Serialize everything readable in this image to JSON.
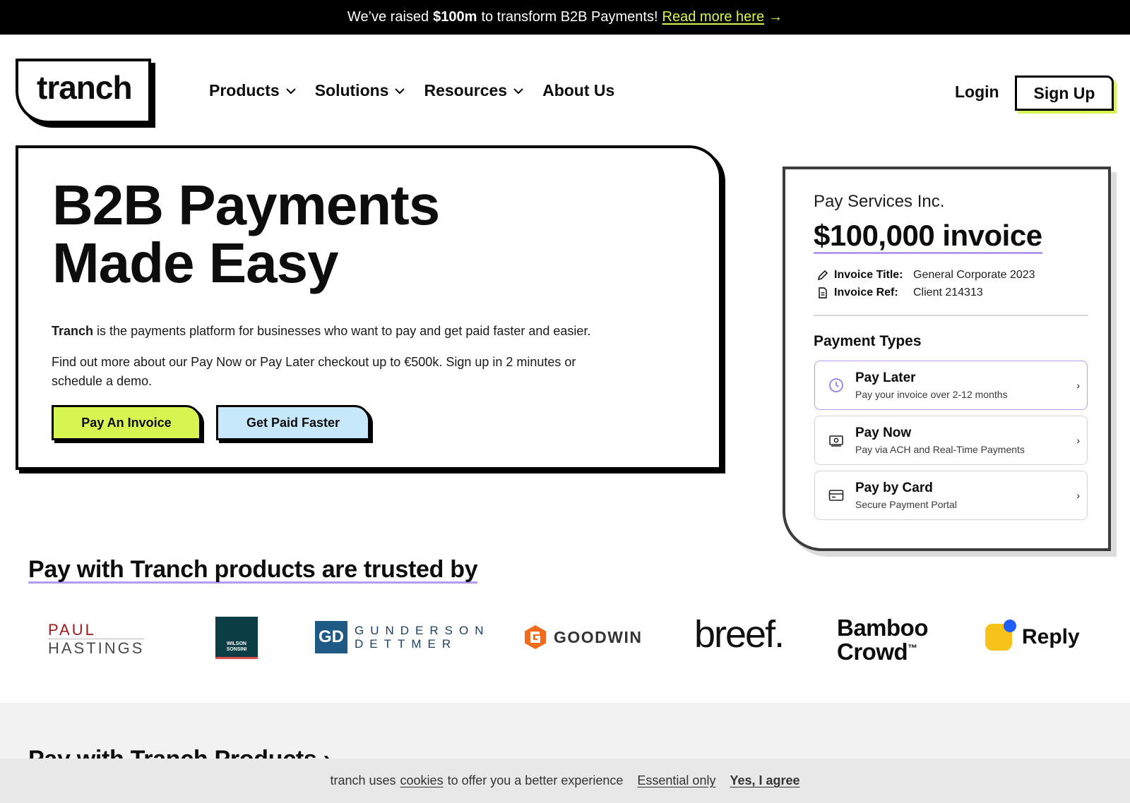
{
  "announcement": {
    "prefix": "We’ve raised",
    "amount": "$100m",
    "suffix": "to transform B2B Payments!",
    "link": "Read more here",
    "arrow": "→"
  },
  "header": {
    "logo_text": "tranch",
    "nav": [
      "Products",
      "Solutions",
      "Resources",
      "About Us"
    ],
    "login": "Login",
    "signup": "Sign Up"
  },
  "hero": {
    "title_line1": "B2B Payments",
    "title_line2": "Made Easy",
    "brand": "Tranch",
    "para1_rest": "is the payments platform for businesses who want to pay and get paid faster and easier.",
    "para2": "Find out more about our Pay Now or Pay Later checkout up to €500k. Sign up in 2 minutes or schedule a demo.",
    "btn_pay": "Pay An Invoice",
    "btn_get": "Get Paid Faster"
  },
  "invoice": {
    "company": "Pay Services Inc.",
    "amount": "$100,000 invoice",
    "title_label": "Invoice Title:",
    "title_value": "General Corporate 2023",
    "ref_label": "Invoice Ref:",
    "ref_value": "Client 214313",
    "payment_types_title": "Payment Types",
    "options": [
      {
        "name": "Pay Later",
        "desc": "Pay your invoice over 2-12 months",
        "icon": "clock-icon"
      },
      {
        "name": "Pay Now",
        "desc": "Pay via ACH and Real-Time Payments",
        "icon": "cash-icon"
      },
      {
        "name": "Pay by Card",
        "desc": "Secure Payment Portal",
        "icon": "card-icon"
      }
    ],
    "arrow": "›"
  },
  "trusted": {
    "title": "Pay with Tranch products are trusted by",
    "logos": {
      "paul_1": "PAUL",
      "paul_2": "HASTINGS",
      "wilson_1": "WILSON",
      "wilson_2": "SONSINI",
      "gund_mono": "GD",
      "gund_1": "GUNDERSON",
      "gund_2": "DETTMER",
      "goodwin": "GOODWIN",
      "breef": "breef.",
      "bamboo_1": "Bamboo",
      "bamboo_2": "Crowd",
      "bamboo_mark": "™",
      "reply": "Reply"
    }
  },
  "products_section": {
    "title": "Pay with Tranch Products",
    "arrow": "›"
  },
  "cookie": {
    "prefix": "tranch uses",
    "link": "cookies",
    "suffix": "to offer you a better experience",
    "essential": "Essential only",
    "agree": "Yes, I agree"
  },
  "colors": {
    "accent_lime": "#d6f550",
    "accent_blue": "#c7e8fb",
    "accent_purple": "#b59cf0"
  }
}
